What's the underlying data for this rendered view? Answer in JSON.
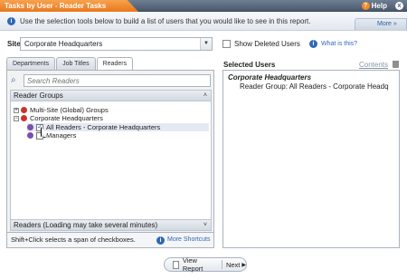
{
  "window": {
    "title": "Tasks by User - Reader Tasks",
    "help_label": "Help",
    "close_glyph": "x"
  },
  "info": {
    "text": "Use the selection tools below to build a list of users that you would like to see in this report.",
    "more_label": "More »"
  },
  "site": {
    "label": "Site",
    "value": "Corporate Headquarters"
  },
  "tabs": [
    {
      "label": "Departments"
    },
    {
      "label": "Job Titles"
    },
    {
      "label": "Readers"
    }
  ],
  "search": {
    "placeholder": "Search Readers"
  },
  "reader_groups": {
    "header": "Reader Groups",
    "collapse_glyph": "˄",
    "tree": [
      {
        "label": "Multi-Site (Global) Groups"
      },
      {
        "label": "Corporate Headquarters"
      },
      {
        "label": "All Readers - Corporate Headquarters"
      },
      {
        "label": "Managers"
      }
    ]
  },
  "readers_bar": {
    "label": "Readers (Loading may take several minutes)",
    "expand_glyph": "˅"
  },
  "hint": {
    "text": "Shift+Click selects a span of checkboxes.",
    "link": "More Shortcuts"
  },
  "options": {
    "show_deleted": "Show Deleted Users",
    "what_is_this": "What is this?"
  },
  "selected_users": {
    "title": "Selected Users",
    "contents_link": "Contents",
    "group_heading": "Corporate Headquarters",
    "item": "Reader Group: All Readers - Corporate Headq"
  },
  "footer": {
    "view_report": "View Report",
    "next": "Next"
  },
  "colors": {
    "accent_orange": "#e8781c",
    "titlebar_gray": "#4a596c",
    "link_blue": "#2f68b5"
  }
}
